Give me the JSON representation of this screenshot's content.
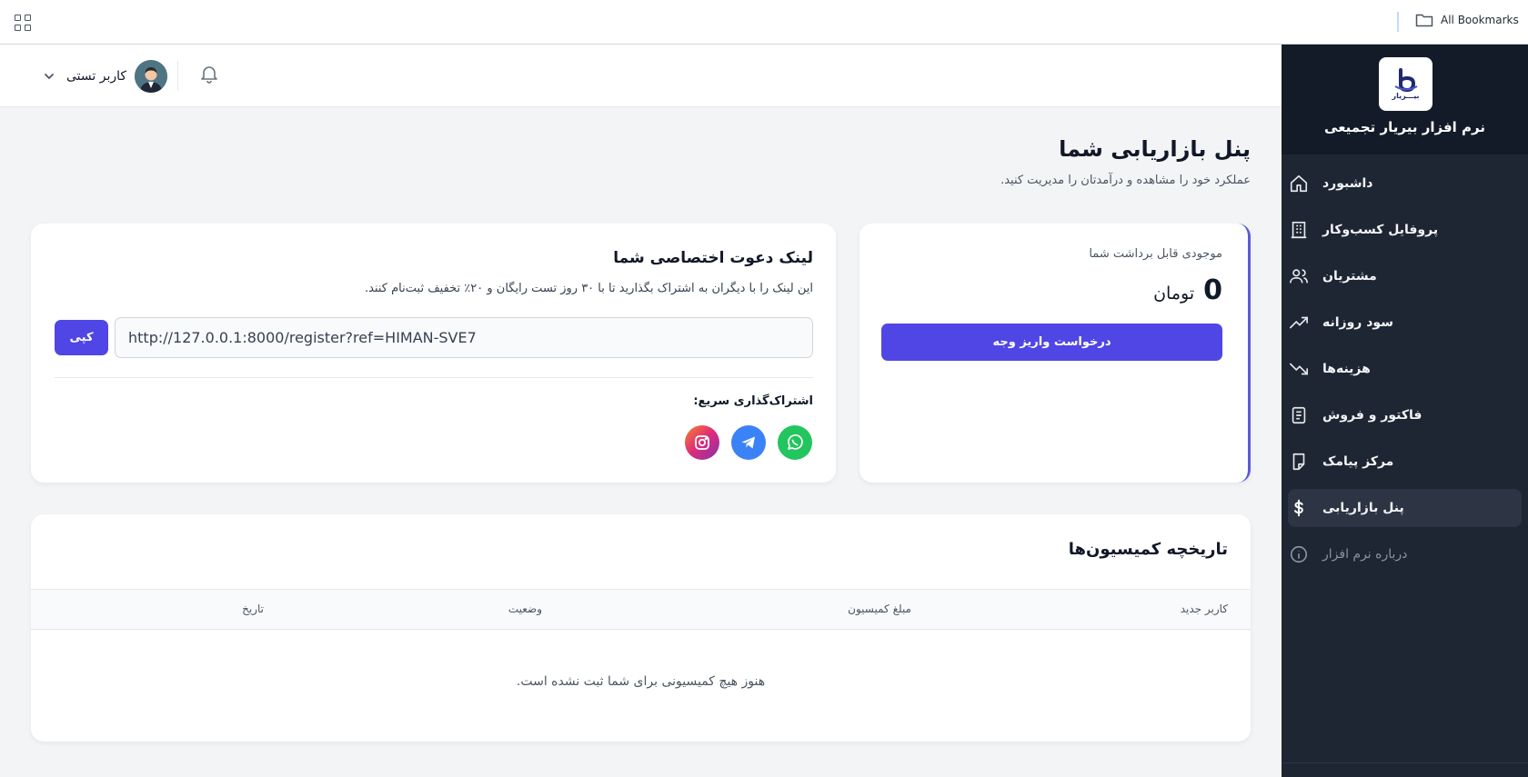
{
  "browser": {
    "bookmarks_label": "All Bookmarks"
  },
  "sidebar": {
    "brand_name": "نرم افزار بیریار تجمیعی",
    "logo_text": "بیـــریار",
    "items": [
      {
        "label": "داشبورد",
        "icon": "home-icon"
      },
      {
        "label": "پروفایل کسب‌وکار",
        "icon": "building-icon"
      },
      {
        "label": "مشتریان",
        "icon": "users-icon"
      },
      {
        "label": "سود روزانه",
        "icon": "trending-up-icon"
      },
      {
        "label": "هزینه‌ها",
        "icon": "trending-down-icon"
      },
      {
        "label": "فاکتور و فروش",
        "icon": "invoice-icon"
      },
      {
        "label": "مرکز پیامک",
        "icon": "message-icon"
      },
      {
        "label": "پنل بازاریابی",
        "icon": "dollar-icon",
        "active": true
      },
      {
        "label": "درباره نرم افزار",
        "icon": "info-icon"
      }
    ]
  },
  "header": {
    "user_name": "کاربر تستی"
  },
  "page": {
    "title": "پنل بازاریابی شما",
    "subtitle": "عملکرد خود را مشاهده و درآمدتان را مدیریت کنید."
  },
  "balance": {
    "label": "موجودی قابل برداشت شما",
    "amount": "0",
    "unit": "تومان",
    "withdraw_label": "درخواست واریز وجه"
  },
  "invite": {
    "title": "لینک دعوت اختصاصی شما",
    "description": "این لینک را با دیگران به اشتراک بگذارید تا با ۳۰ روز تست رایگان و ۲۰٪ تخفیف ثبت‌نام کنند.",
    "link": "http://127.0.0.1:8000/register?ref=HIMAN-SVE7",
    "copy_label": "کپی",
    "share_label": "اشتراک‌گذاری سریع:"
  },
  "history": {
    "title": "تاریخچه کمیسیون‌ها",
    "columns": [
      "کاربر جدید",
      "مبلغ کمیسیون",
      "وضعیت",
      "تاریخ"
    ],
    "empty_text": "هنوز هیچ کمیسیونی برای شما ثبت نشده است."
  },
  "colors": {
    "accent": "#4f46e5",
    "sidebar_bg": "#1e2533",
    "brand_bg": "#141b28"
  }
}
